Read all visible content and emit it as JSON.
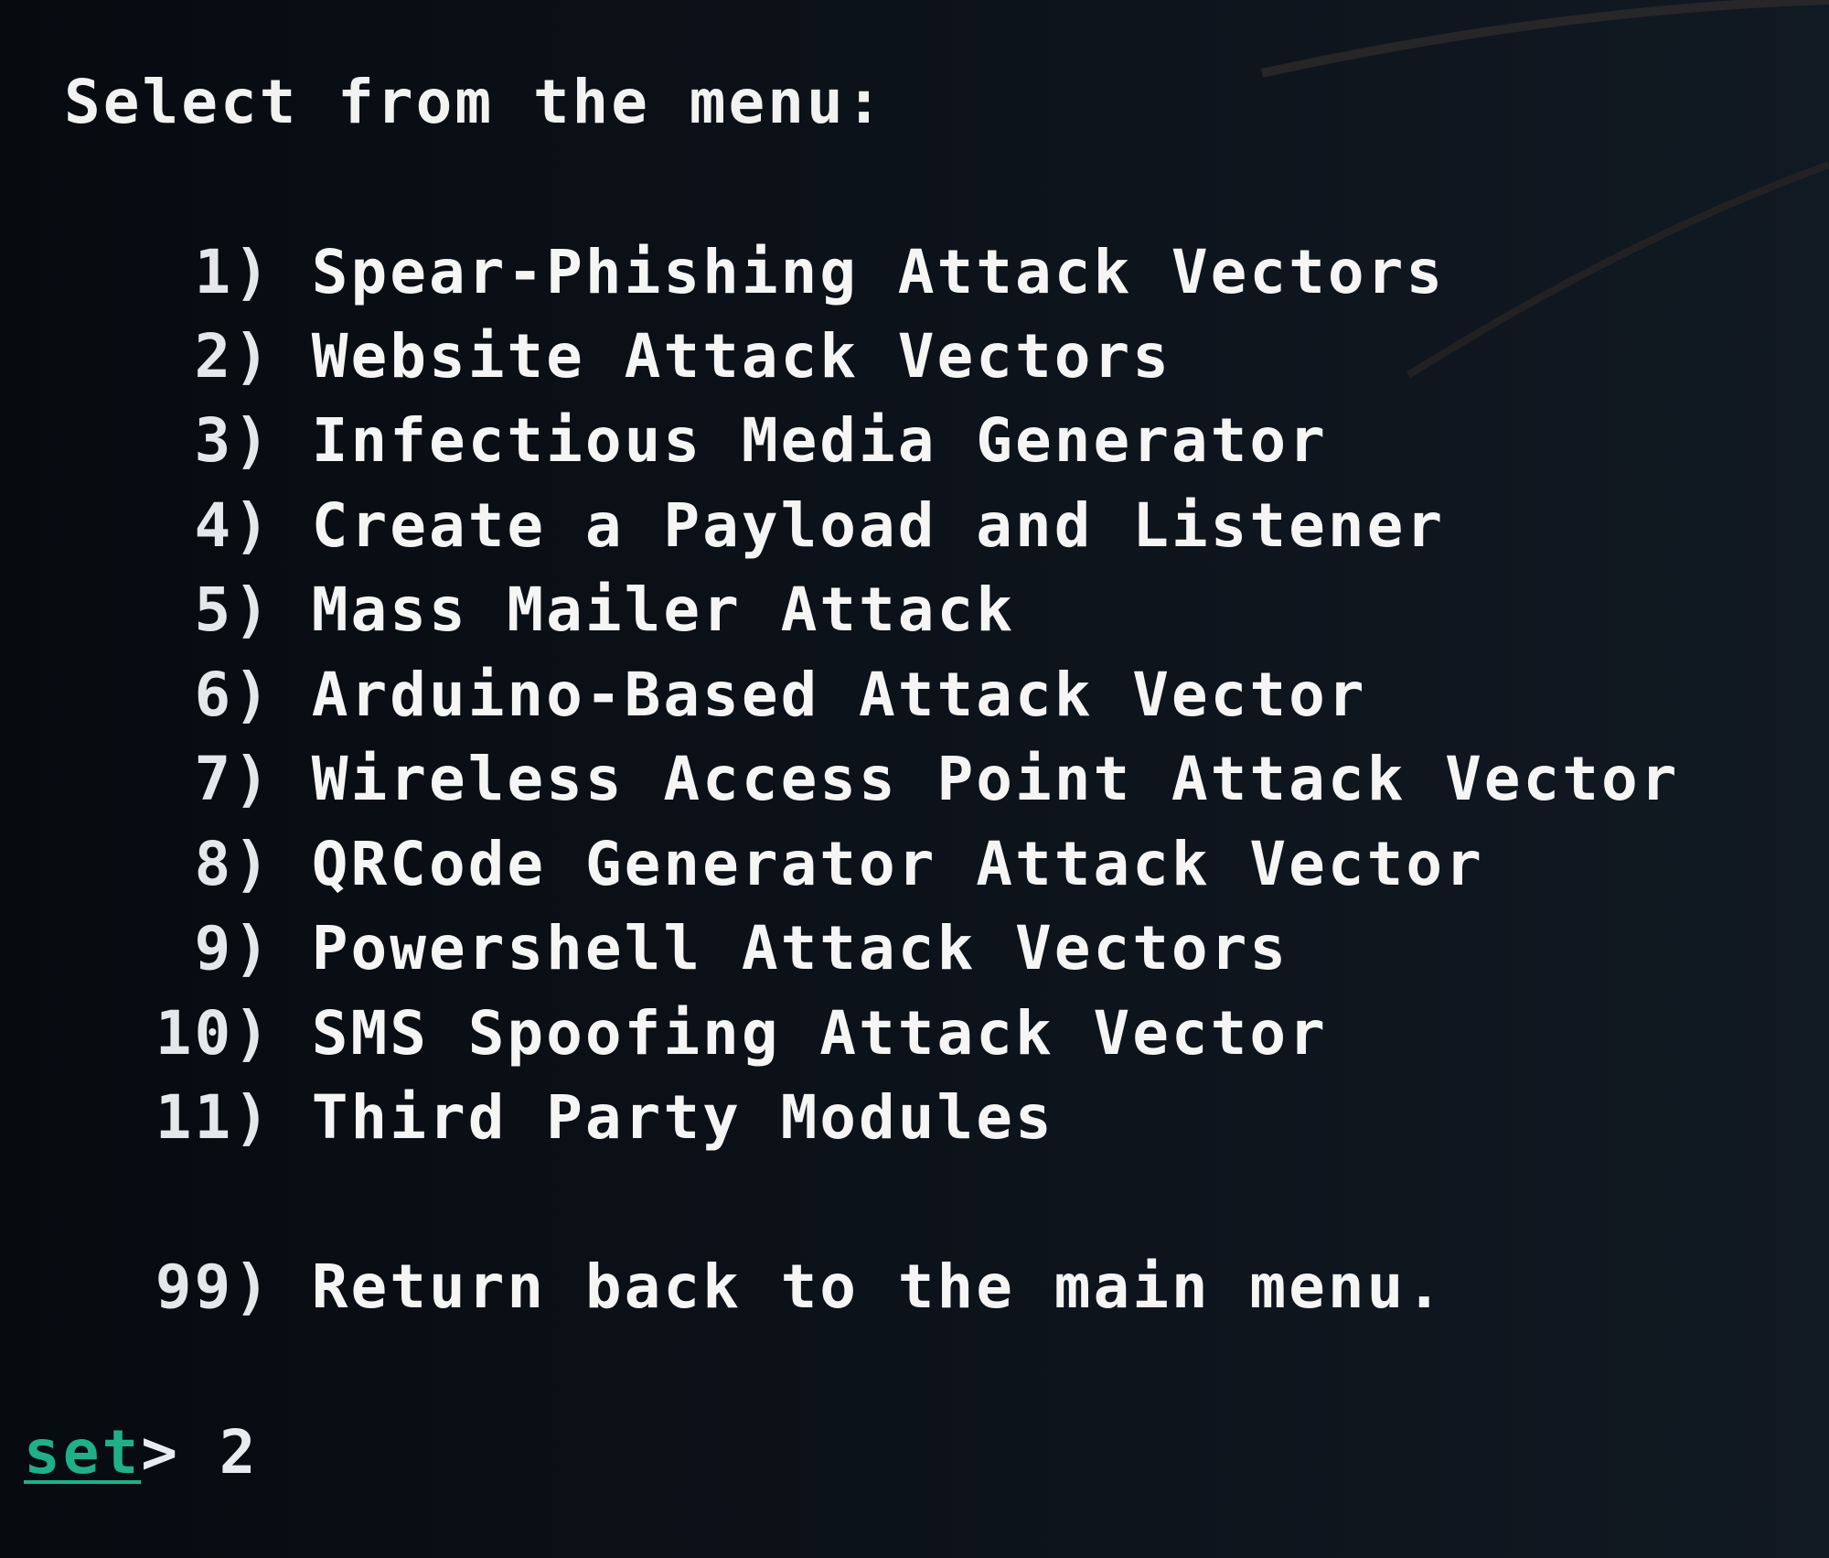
{
  "terminal": {
    "heading": "Select from the menu:",
    "menu_items": [
      {
        "number": "1)",
        "label": "Spear-Phishing Attack Vectors"
      },
      {
        "number": "2)",
        "label": "Website Attack Vectors"
      },
      {
        "number": "3)",
        "label": "Infectious Media Generator"
      },
      {
        "number": "4)",
        "label": "Create a Payload and Listener"
      },
      {
        "number": "5)",
        "label": "Mass Mailer Attack"
      },
      {
        "number": "6)",
        "label": "Arduino-Based Attack Vector"
      },
      {
        "number": "7)",
        "label": "Wireless Access Point Attack Vector"
      },
      {
        "number": "8)",
        "label": "QRCode Generator Attack Vector"
      },
      {
        "number": "9)",
        "label": "Powershell Attack Vectors"
      },
      {
        "number": "10)",
        "label": "SMS Spoofing Attack Vector"
      },
      {
        "number": "11)",
        "label": "Third Party Modules"
      }
    ],
    "return_item": {
      "number": "99)",
      "label": "Return back to the main menu."
    },
    "prompt": {
      "name": "set",
      "symbol": "> ",
      "input_value": "2"
    }
  },
  "colors": {
    "background": "#0b1119",
    "text": "#e8ecef",
    "prompt_accent": "#1fb08a"
  }
}
